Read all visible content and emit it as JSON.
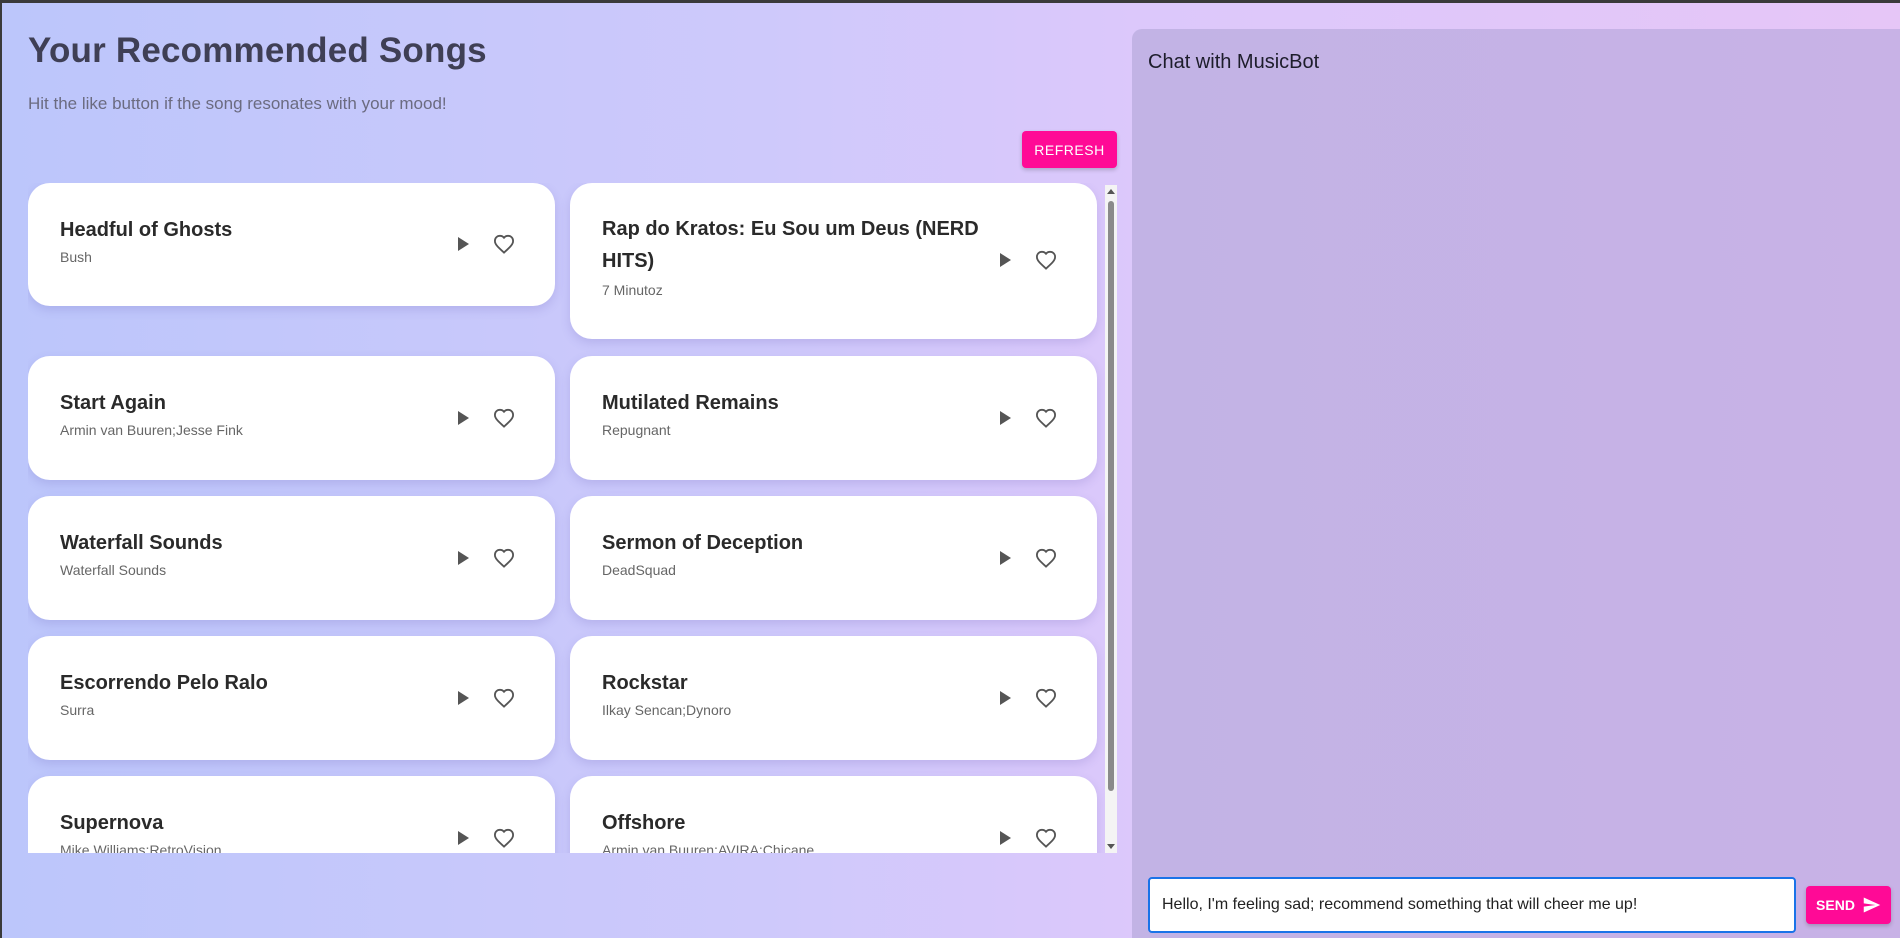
{
  "header": {
    "title": "Your Recommended Songs",
    "subtitle": "Hit the like button if the song resonates with your mood!"
  },
  "toolbar": {
    "refresh_label": "REFRESH"
  },
  "songs": [
    {
      "name": "Headful of Ghosts",
      "artist": "Bush"
    },
    {
      "name": "Rap do Kratos: Eu Sou um Deus (NERD HITS)",
      "artist": "7 Minutoz"
    },
    {
      "name": "Start Again",
      "artist": "Armin van Buuren;Jesse Fink"
    },
    {
      "name": "Mutilated Remains",
      "artist": "Repugnant"
    },
    {
      "name": "Waterfall Sounds",
      "artist": "Waterfall Sounds"
    },
    {
      "name": "Sermon of Deception",
      "artist": "DeadSquad"
    },
    {
      "name": "Escorrendo Pelo Ralo",
      "artist": "Surra"
    },
    {
      "name": "Rockstar",
      "artist": "Ilkay Sencan;Dynoro"
    },
    {
      "name": "Supernova",
      "artist": "Mike Williams;RetroVision"
    },
    {
      "name": "Offshore",
      "artist": "Armin van Buuren;AVIRA;Chicane"
    }
  ],
  "icons": {
    "play": "play-icon",
    "like": "heart-outline-icon",
    "send": "send-icon"
  },
  "chat": {
    "title": "Chat with MusicBot",
    "input_value": "Hello, I'm feeling sad; recommend something that will cheer me up!",
    "send_label": "SEND"
  },
  "colors": {
    "accent": "#ff0a96",
    "input_focus": "#1a73e8"
  }
}
